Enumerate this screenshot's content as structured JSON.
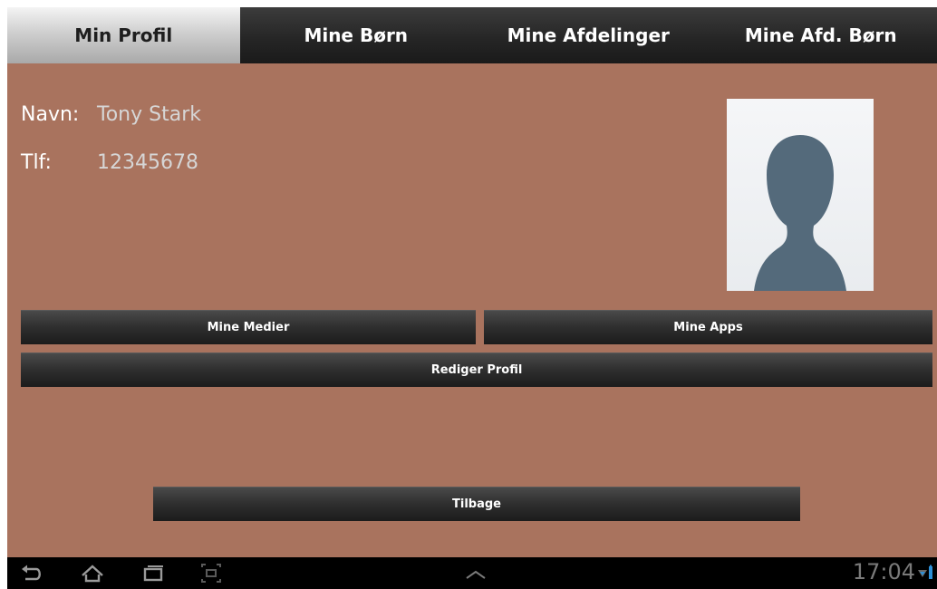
{
  "tabs": [
    {
      "label": "Min Profil",
      "active": true
    },
    {
      "label": "Mine Børn",
      "active": false
    },
    {
      "label": "Mine Afdelinger",
      "active": false
    },
    {
      "label": "Mine Afd. Børn",
      "active": false
    }
  ],
  "profile": {
    "name_label": "Navn:",
    "name_value": "Tony Stark",
    "phone_label": "Tlf:",
    "phone_value": "12345678"
  },
  "buttons": {
    "media": "Mine Medier",
    "apps": "Mine Apps",
    "edit_profile": "Rediger Profil",
    "back": "Tilbage"
  },
  "status_bar": {
    "time": "17:04",
    "icons": [
      "back-icon",
      "home-icon",
      "recent-apps-icon",
      "screenshot-icon",
      "chevron-up-icon",
      "wifi-icon",
      "battery-icon"
    ]
  },
  "colors": {
    "background": "#a9735e",
    "avatar_silhouette": "#546a7b",
    "active_tab": "#cfcfcf"
  }
}
